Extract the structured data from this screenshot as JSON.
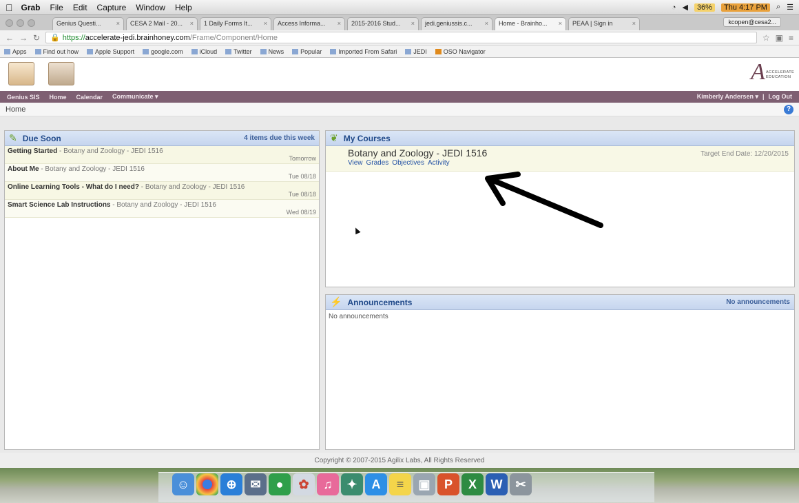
{
  "menubar": {
    "apple": "",
    "items": [
      "Grab",
      "File",
      "Edit",
      "Capture",
      "Window",
      "Help"
    ],
    "battery": "36%",
    "clock": "Thu 4:17 PM"
  },
  "browser": {
    "tabs": [
      "Genius Questi...",
      "CESA 2 Mail - 20...",
      "1 Daily Forms It...",
      "Access Informa...",
      "2015-2016 Stud...",
      "jedi.geniussis.c...",
      "Home - Brainho...",
      "PEAA | Sign in"
    ],
    "profile": "kcopen@cesa2...",
    "url": {
      "scheme": "https://",
      "host": "accelerate-jedi.brainhoney.com",
      "path": "/Frame/Component/Home"
    },
    "bookmarks": [
      "Apps",
      "Find out how",
      "Apple Support",
      "google.com",
      "iCloud",
      "Twitter",
      "News",
      "Popular",
      "Imported From Safari",
      "JEDI",
      "OSO Navigator"
    ]
  },
  "lms": {
    "brand": {
      "letter": "A",
      "line1": "ACCELERATE",
      "line2": "EDUCATION"
    },
    "nav": [
      "Genius SIS",
      "Home",
      "Calendar",
      "Communicate ▾"
    ],
    "user": "Kimberly Andersen ▾",
    "logout": "Log Out",
    "breadcrumb": "Home"
  },
  "due_soon": {
    "title": "Due Soon",
    "count_text": "4 items due this week",
    "items": [
      {
        "name": "Getting Started",
        "course": " - Botany and Zoology - JEDI 1516",
        "date": "Tomorrow"
      },
      {
        "name": "About Me",
        "course": " - Botany and Zoology - JEDI 1516",
        "date": "Tue 08/18"
      },
      {
        "name": "Online Learning Tools - What do I need?",
        "course": " - Botany and Zoology - JEDI 1516",
        "date": "Tue 08/18"
      },
      {
        "name": "Smart Science Lab Instructions",
        "course": " - Botany and Zoology - JEDI 1516",
        "date": "Wed 08/19"
      }
    ]
  },
  "courses": {
    "title": "My Courses",
    "items": [
      {
        "title": "Botany and Zoology - JEDI 1516",
        "target": "Target End Date: 12/20/2015",
        "links": [
          "View",
          "Grades",
          "Objectives",
          "Activity"
        ]
      }
    ]
  },
  "announcements": {
    "title": "Announcements",
    "meta": "No announcements",
    "body": "No announcements"
  },
  "footer": "Copyright © 2007-2015 Agilix Labs, All Rights Reserved",
  "dock_apps": [
    "Finder",
    "Chrome",
    "Safari",
    "Mail",
    "FaceTime",
    "Photos",
    "iTunes",
    "iPhoto",
    "App Store",
    "Notes",
    "Preview",
    "PowerPoint",
    "Excel",
    "Word",
    "Grab"
  ],
  "colors": {
    "nav": "#7e5f72",
    "panel_head": "#c6d5ee",
    "link": "#2452a4"
  }
}
